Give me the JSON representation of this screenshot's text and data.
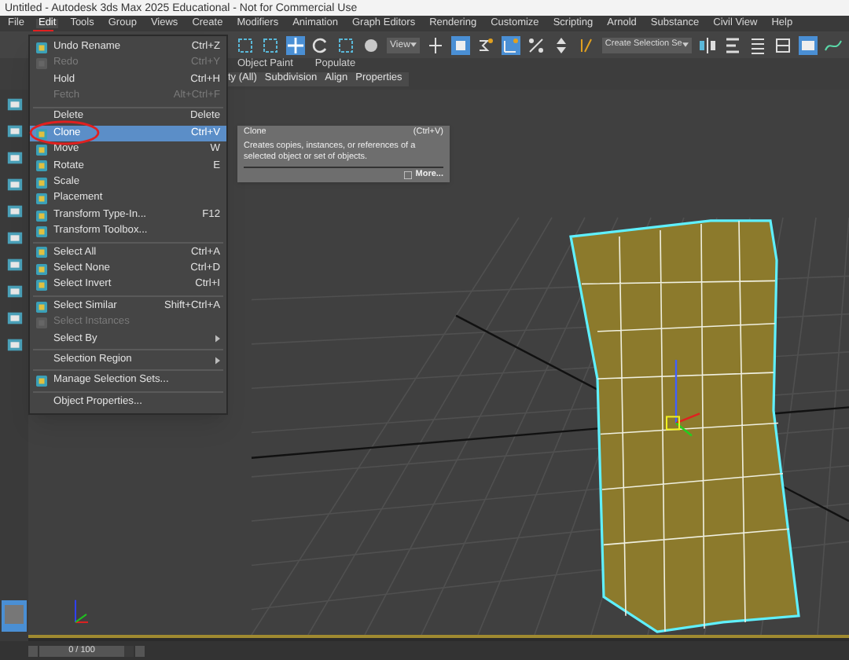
{
  "window": {
    "title": "Untitled - Autodesk 3ds Max 2025 Educational - Not for Commercial Use"
  },
  "menu_bar": [
    {
      "label": "File",
      "selected": false
    },
    {
      "label": "Edit",
      "selected": true
    },
    {
      "label": "Tools",
      "selected": false
    },
    {
      "label": "Group",
      "selected": false
    },
    {
      "label": "Views",
      "selected": false
    },
    {
      "label": "Create",
      "selected": false
    },
    {
      "label": "Modifiers",
      "selected": false
    },
    {
      "label": "Animation",
      "selected": false
    },
    {
      "label": "Graph Editors",
      "selected": false
    },
    {
      "label": "Rendering",
      "selected": false
    },
    {
      "label": "Customize",
      "selected": false
    },
    {
      "label": "Scripting",
      "selected": false
    },
    {
      "label": "Arnold",
      "selected": false
    },
    {
      "label": "Substance",
      "selected": false
    },
    {
      "label": "Civil View",
      "selected": false
    },
    {
      "label": "Help",
      "selected": false
    }
  ],
  "toolbar": {
    "view_dropdown": "View",
    "selection_set_dropdown": "Create Selection Se"
  },
  "ribbon": {
    "tabs": [
      "Object Paint",
      "Populate"
    ],
    "row": [
      "ty (All)",
      "Subdivision",
      "Align",
      "Properties"
    ]
  },
  "edit_menu": [
    {
      "kind": "item",
      "label": "Undo Rename",
      "shortcut": "Ctrl+Z",
      "icon": true,
      "disabled": false,
      "selected": false,
      "submenu": false
    },
    {
      "kind": "item",
      "label": "Redo",
      "shortcut": "Ctrl+Y",
      "icon": true,
      "disabled": true,
      "selected": false,
      "submenu": false
    },
    {
      "kind": "item",
      "label": "Hold",
      "shortcut": "Ctrl+H",
      "icon": false,
      "disabled": false,
      "selected": false,
      "submenu": false
    },
    {
      "kind": "item",
      "label": "Fetch",
      "shortcut": "Alt+Ctrl+F",
      "icon": false,
      "disabled": true,
      "selected": false,
      "submenu": false
    },
    {
      "kind": "divider"
    },
    {
      "kind": "item",
      "label": "Delete",
      "shortcut": "Delete",
      "icon": false,
      "disabled": false,
      "selected": false,
      "submenu": false
    },
    {
      "kind": "item",
      "label": "Clone",
      "shortcut": "Ctrl+V",
      "icon": true,
      "disabled": false,
      "selected": true,
      "submenu": false
    },
    {
      "kind": "item",
      "label": "Move",
      "shortcut": "W",
      "icon": true,
      "disabled": false,
      "selected": false,
      "submenu": false
    },
    {
      "kind": "item",
      "label": "Rotate",
      "shortcut": "E",
      "icon": true,
      "disabled": false,
      "selected": false,
      "submenu": false
    },
    {
      "kind": "item",
      "label": "Scale",
      "icon": true,
      "disabled": false,
      "selected": false,
      "submenu": false
    },
    {
      "kind": "item",
      "label": "Placement",
      "icon": true,
      "disabled": false,
      "selected": false,
      "submenu": false
    },
    {
      "kind": "item",
      "label": "Transform Type-In...",
      "shortcut": "F12",
      "icon": true,
      "disabled": false,
      "selected": false,
      "submenu": false
    },
    {
      "kind": "item",
      "label": "Transform Toolbox...",
      "icon": true,
      "disabled": false,
      "selected": false,
      "submenu": false
    },
    {
      "kind": "divider"
    },
    {
      "kind": "item",
      "label": "Select All",
      "shortcut": "Ctrl+A",
      "icon": true,
      "disabled": false,
      "selected": false,
      "submenu": false
    },
    {
      "kind": "item",
      "label": "Select None",
      "shortcut": "Ctrl+D",
      "icon": true,
      "disabled": false,
      "selected": false,
      "submenu": false
    },
    {
      "kind": "item",
      "label": "Select Invert",
      "shortcut": "Ctrl+I",
      "icon": true,
      "disabled": false,
      "selected": false,
      "submenu": false
    },
    {
      "kind": "divider"
    },
    {
      "kind": "item",
      "label": "Select Similar",
      "shortcut": "Shift+Ctrl+A",
      "icon": true,
      "disabled": false,
      "selected": false,
      "submenu": false
    },
    {
      "kind": "item",
      "label": "Select Instances",
      "icon": true,
      "disabled": true,
      "selected": false,
      "submenu": false
    },
    {
      "kind": "item",
      "label": "Select By",
      "icon": false,
      "disabled": false,
      "selected": false,
      "submenu": true
    },
    {
      "kind": "divider"
    },
    {
      "kind": "item",
      "label": "Selection Region",
      "icon": false,
      "disabled": false,
      "selected": false,
      "submenu": true
    },
    {
      "kind": "divider"
    },
    {
      "kind": "item",
      "label": "Manage Selection Sets...",
      "icon": true,
      "disabled": false,
      "selected": false,
      "submenu": false
    },
    {
      "kind": "divider"
    },
    {
      "kind": "item",
      "label": "Object Properties...",
      "icon": false,
      "disabled": false,
      "selected": false,
      "submenu": false
    }
  ],
  "tooltip": {
    "title": "Clone",
    "shortcut": "(Ctrl+V)",
    "description": "Creates copies, instances, or references of a selected object or set of objects.",
    "link": "More..."
  },
  "timeline": {
    "frame": "0 / 100",
    "level": 0
  }
}
